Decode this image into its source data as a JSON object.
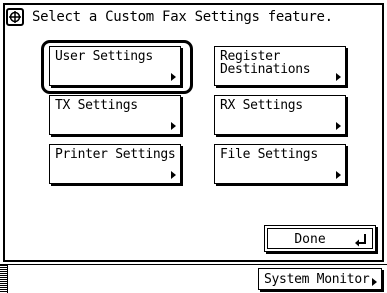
{
  "header": {
    "icon": "fax-settings-icon",
    "instruction": "Select a Custom Fax Settings feature."
  },
  "buttons": [
    {
      "label": "User Settings",
      "selected": true
    },
    {
      "label": "Register\nDestinations",
      "selected": false
    },
    {
      "label": "TX Settings",
      "selected": false
    },
    {
      "label": "RX Settings",
      "selected": false
    },
    {
      "label": "Printer Settings",
      "selected": false
    },
    {
      "label": "File Settings",
      "selected": false
    }
  ],
  "done": {
    "label": "Done",
    "icon": "enter-icon"
  },
  "status": {
    "system_monitor_label": "System Monitor"
  },
  "colors": {
    "foreground": "#000000",
    "background": "#ffffff"
  }
}
